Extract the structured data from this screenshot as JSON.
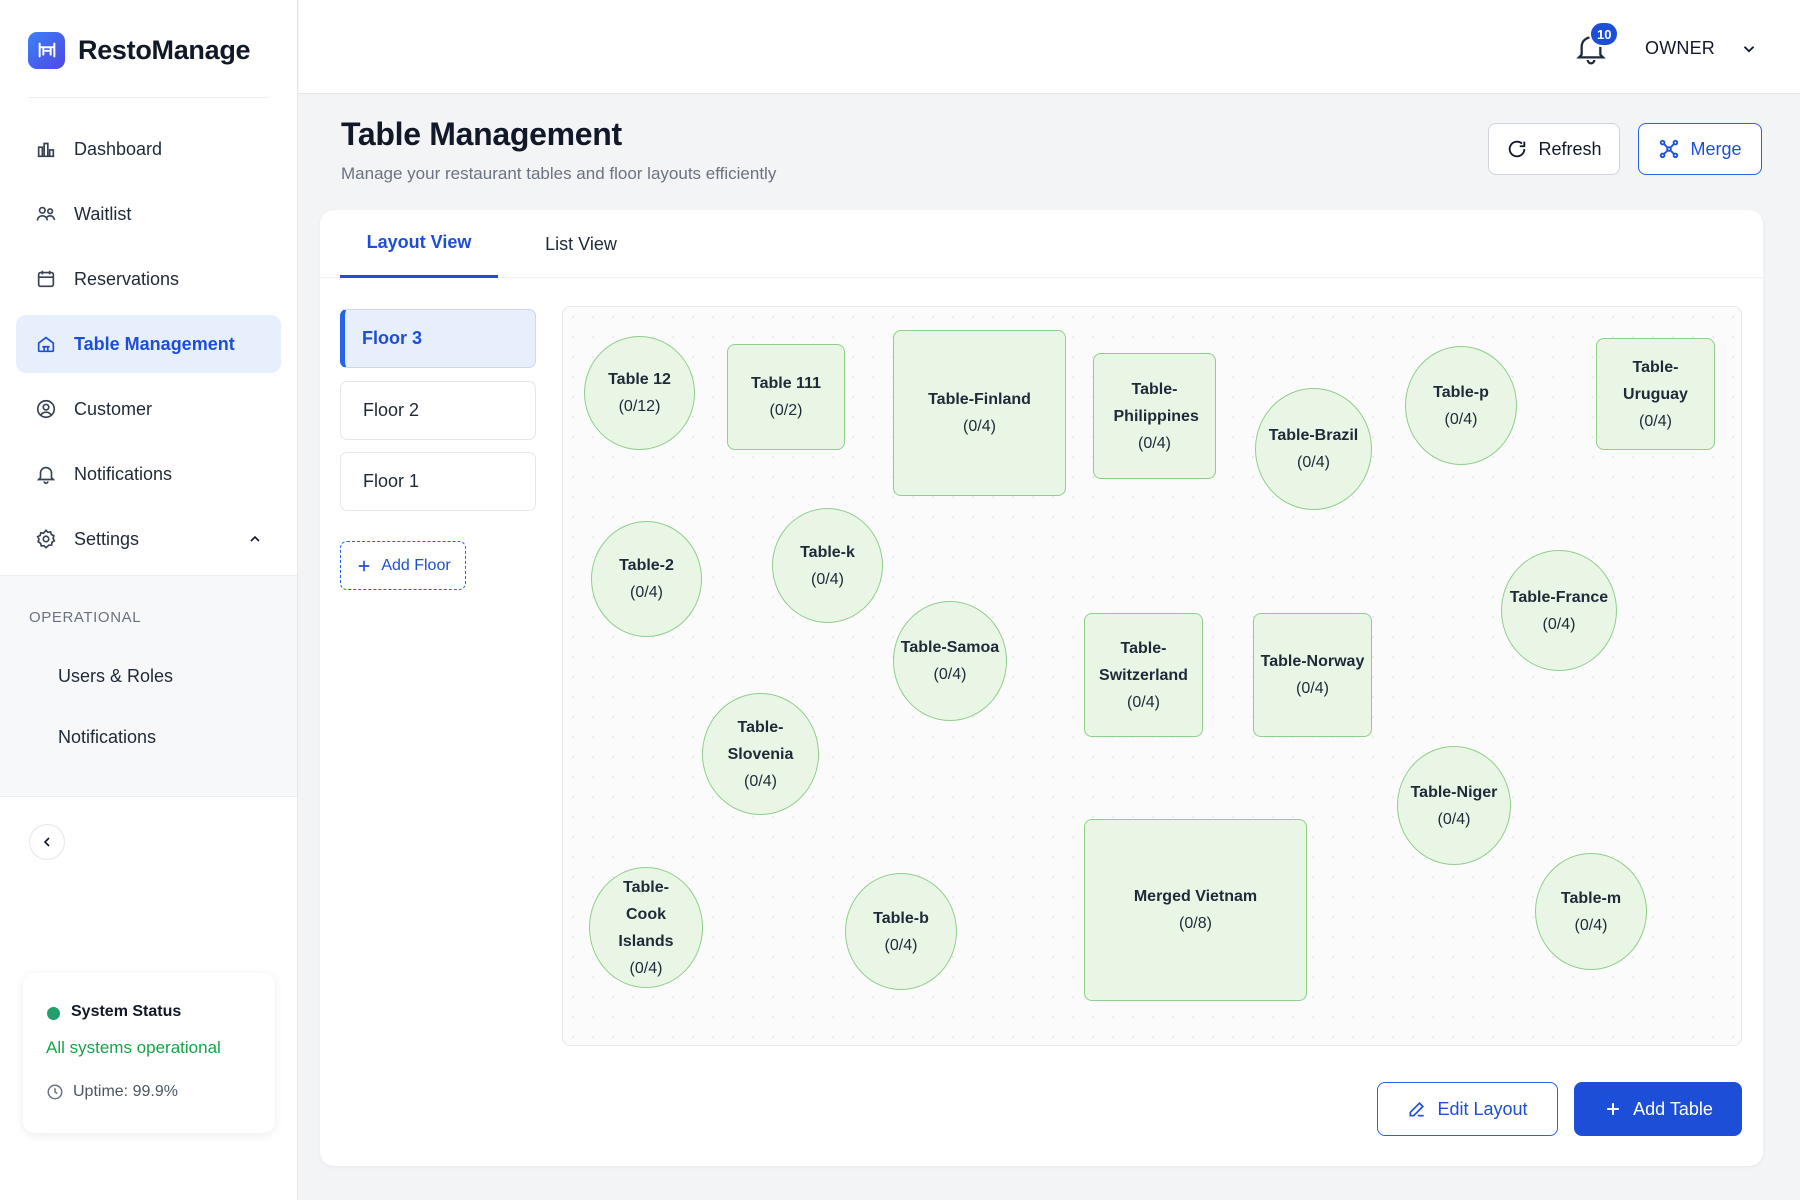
{
  "brand": {
    "name": "RestoManage"
  },
  "sidebar": {
    "items": [
      {
        "label": "Dashboard",
        "icon": "dashboard-icon"
      },
      {
        "label": "Waitlist",
        "icon": "waitlist-icon"
      },
      {
        "label": "Reservations",
        "icon": "calendar-icon"
      },
      {
        "label": "Table Management",
        "icon": "table-icon",
        "active": true
      },
      {
        "label": "Customer",
        "icon": "user-icon"
      },
      {
        "label": "Notifications",
        "icon": "bell-icon"
      },
      {
        "label": "Settings",
        "icon": "gear-icon",
        "expanded": true
      }
    ],
    "section_title": "OPERATIONAL",
    "section_items": [
      "Users & Roles",
      "Notifications"
    ]
  },
  "status": {
    "title": "System Status",
    "text": "All systems operational",
    "uptime": "Uptime: 99.9%"
  },
  "header": {
    "notification_count": "10",
    "user_role": "OWNER"
  },
  "page": {
    "title": "Table Management",
    "subtitle": "Manage your restaurant tables and floor layouts efficiently",
    "refresh_label": "Refresh",
    "merge_label": "Merge"
  },
  "tabs": [
    {
      "label": "Layout View",
      "active": true
    },
    {
      "label": "List View",
      "active": false
    }
  ],
  "floors": [
    {
      "label": "Floor 3",
      "active": true
    },
    {
      "label": "Floor 2",
      "active": false
    },
    {
      "label": "Floor 1",
      "active": false
    }
  ],
  "add_floor_label": "Add Floor",
  "tables": [
    {
      "name": "Table 12",
      "capacity": "(0/12)",
      "shape": "round"
    },
    {
      "name": "Table 111",
      "capacity": "(0/2)",
      "shape": "square"
    },
    {
      "name": "Table-Finland",
      "capacity": "(0/4)",
      "shape": "square"
    },
    {
      "name": "Table-Philippines",
      "capacity": "(0/4)",
      "shape": "square"
    },
    {
      "name": "Table-Brazil",
      "capacity": "(0/4)",
      "shape": "round"
    },
    {
      "name": "Table-p",
      "capacity": "(0/4)",
      "shape": "round"
    },
    {
      "name": "Table-Uruguay",
      "capacity": "(0/4)",
      "shape": "square"
    },
    {
      "name": "Table-2",
      "capacity": "(0/4)",
      "shape": "round"
    },
    {
      "name": "Table-k",
      "capacity": "(0/4)",
      "shape": "round"
    },
    {
      "name": "Table-France",
      "capacity": "(0/4)",
      "shape": "round"
    },
    {
      "name": "Table-Samoa",
      "capacity": "(0/4)",
      "shape": "round"
    },
    {
      "name": "Table-Switzerland",
      "capacity": "(0/4)",
      "shape": "square"
    },
    {
      "name": "Table-Norway",
      "capacity": "(0/4)",
      "shape": "square"
    },
    {
      "name": "Table-Slovenia",
      "capacity": "(0/4)",
      "shape": "round"
    },
    {
      "name": "Table-Niger",
      "capacity": "(0/4)",
      "shape": "round"
    },
    {
      "name": "Table-Cook Islands",
      "capacity": "(0/4)",
      "shape": "round"
    },
    {
      "name": "Table-b",
      "capacity": "(0/4)",
      "shape": "round"
    },
    {
      "name": "Merged Vietnam",
      "capacity": "(0/8)",
      "shape": "square"
    },
    {
      "name": "Table-m",
      "capacity": "(0/4)",
      "shape": "round"
    }
  ],
  "actions": {
    "edit_layout_label": "Edit Layout",
    "add_table_label": "Add Table"
  },
  "colors": {
    "accent": "#1d4ed8",
    "table_fill": "#e9f6e6",
    "table_border": "#8fcf8a",
    "status_green": "#22a06b"
  }
}
